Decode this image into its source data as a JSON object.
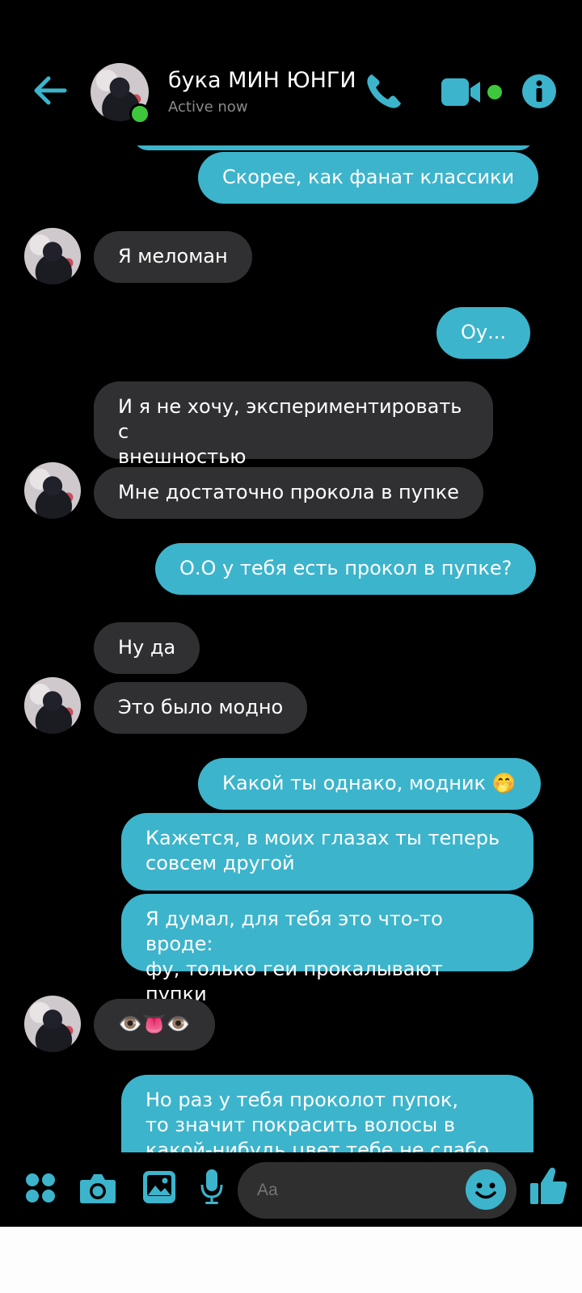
{
  "colors": {
    "accent": "#3cb4cc",
    "incoming_bubble": "#303033",
    "online": "#3ec73c",
    "background": "#000000"
  },
  "header": {
    "contact_name": "бука МИН ЮНГИ",
    "status": "Active now",
    "icons": [
      "back-arrow-icon",
      "phone-icon",
      "video-call-icon",
      "info-icon"
    ]
  },
  "messages": [
    {
      "direction": "outgoing",
      "text": "Скорее, как фанат классики"
    },
    {
      "direction": "incoming",
      "text": "Я меломан"
    },
    {
      "direction": "outgoing",
      "text": "Оу..."
    },
    {
      "direction": "incoming",
      "text": "И я не хочу, экспериментировать с\nвнешностью"
    },
    {
      "direction": "incoming",
      "text": "Мне достаточно прокола в пупке"
    },
    {
      "direction": "outgoing",
      "text": "О.О у тебя есть прокол в пупке?"
    },
    {
      "direction": "incoming",
      "text": "Ну да"
    },
    {
      "direction": "incoming",
      "text": "Это было модно"
    },
    {
      "direction": "outgoing",
      "text": "Какой ты однако, модник 🤭"
    },
    {
      "direction": "outgoing",
      "text": "Кажется, в моих глазах ты теперь\nсовсем другой"
    },
    {
      "direction": "outgoing",
      "text": "Я думал, для тебя это что-то вроде:\nфу, только геи прокалывают пупки"
    },
    {
      "direction": "incoming",
      "text": "👁️👅👁️"
    },
    {
      "direction": "outgoing",
      "text": "Но раз у тебя проколот пупок,\nто значит покрасить волосы в\nкакой-нибудь цвет тебе не слабо"
    }
  ],
  "composer": {
    "placeholder": "Aa",
    "icons": [
      "apps-grid-icon",
      "camera-icon",
      "gallery-icon",
      "microphone-icon",
      "emoji-icon",
      "thumbs-up-icon"
    ]
  }
}
